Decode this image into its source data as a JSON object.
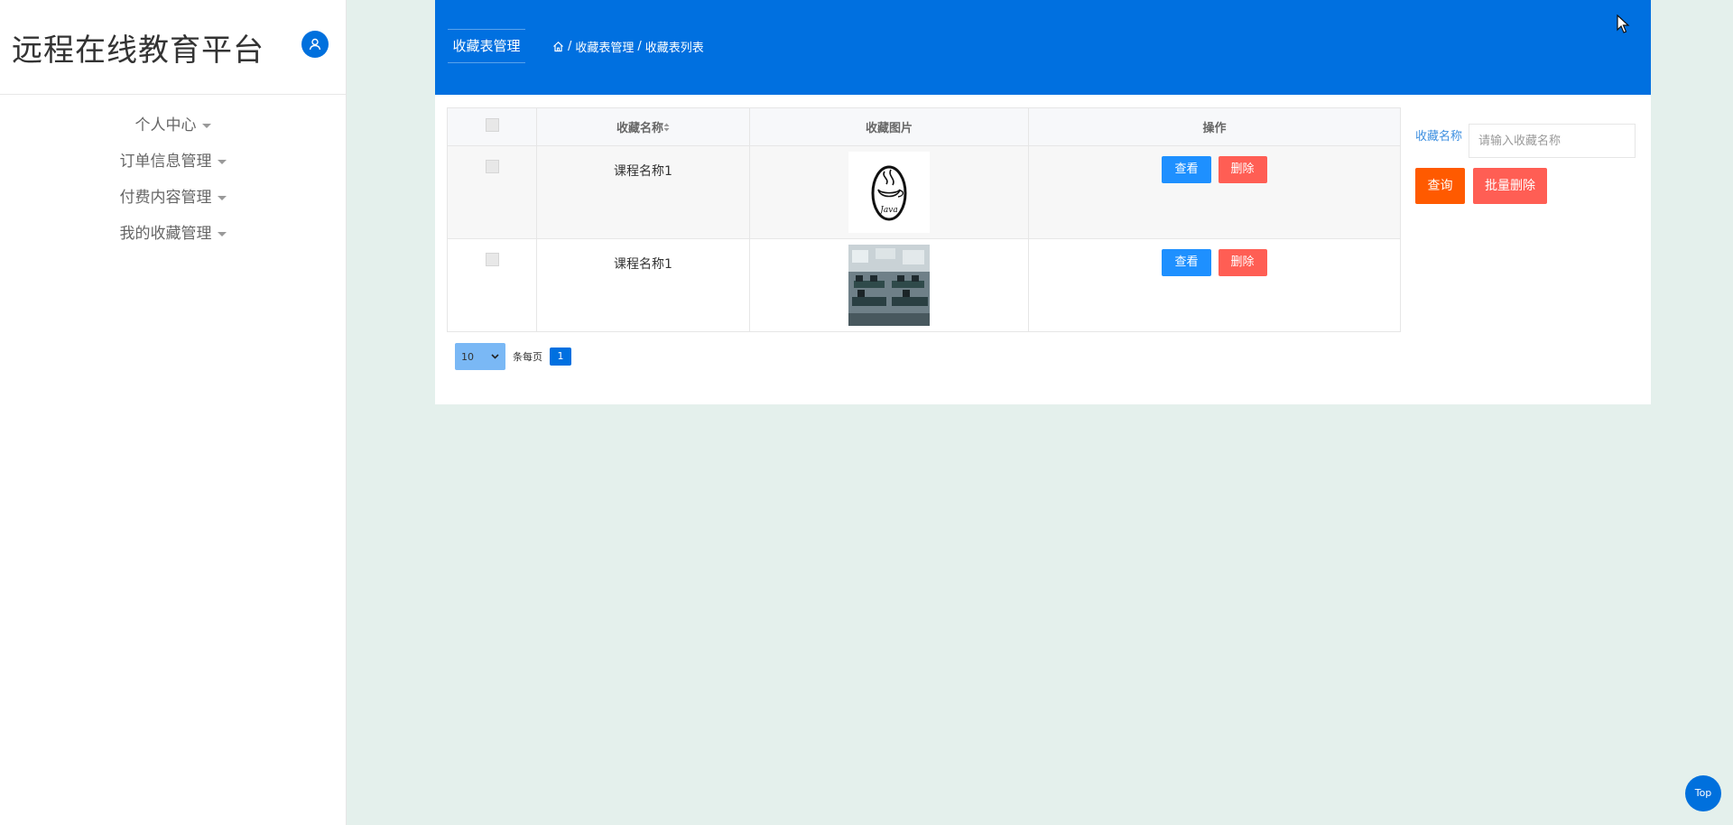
{
  "sidebar": {
    "title": "远程在线教育平台",
    "menu": [
      {
        "label": "个人中心"
      },
      {
        "label": "订单信息管理"
      },
      {
        "label": "付费内容管理"
      },
      {
        "label": "我的收藏管理"
      }
    ]
  },
  "header": {
    "tab": "收藏表管理",
    "breadcrumb": [
      "收藏表管理",
      "收藏表列表"
    ]
  },
  "table": {
    "columns": [
      "收藏名称",
      "收藏图片",
      "操作"
    ],
    "rows": [
      {
        "name": "课程名称1",
        "image": "java-logo-icon"
      },
      {
        "name": "课程名称1",
        "image": "classroom-photo"
      }
    ],
    "view_label": "查看",
    "delete_label": "删除"
  },
  "pager": {
    "page_size": "10",
    "per_page_label": "条每页",
    "current_page": "1"
  },
  "search": {
    "label": "收藏名称",
    "placeholder": "请输入收藏名称",
    "query_label": "查询",
    "batch_delete_label": "批量删除"
  },
  "top_button": "Top",
  "colors": {
    "header": "#0070e0",
    "background": "#e4f0ec",
    "view_button": "#1e90ff",
    "delete_button": "#ff5e54",
    "query_button": "#ff5a00"
  }
}
